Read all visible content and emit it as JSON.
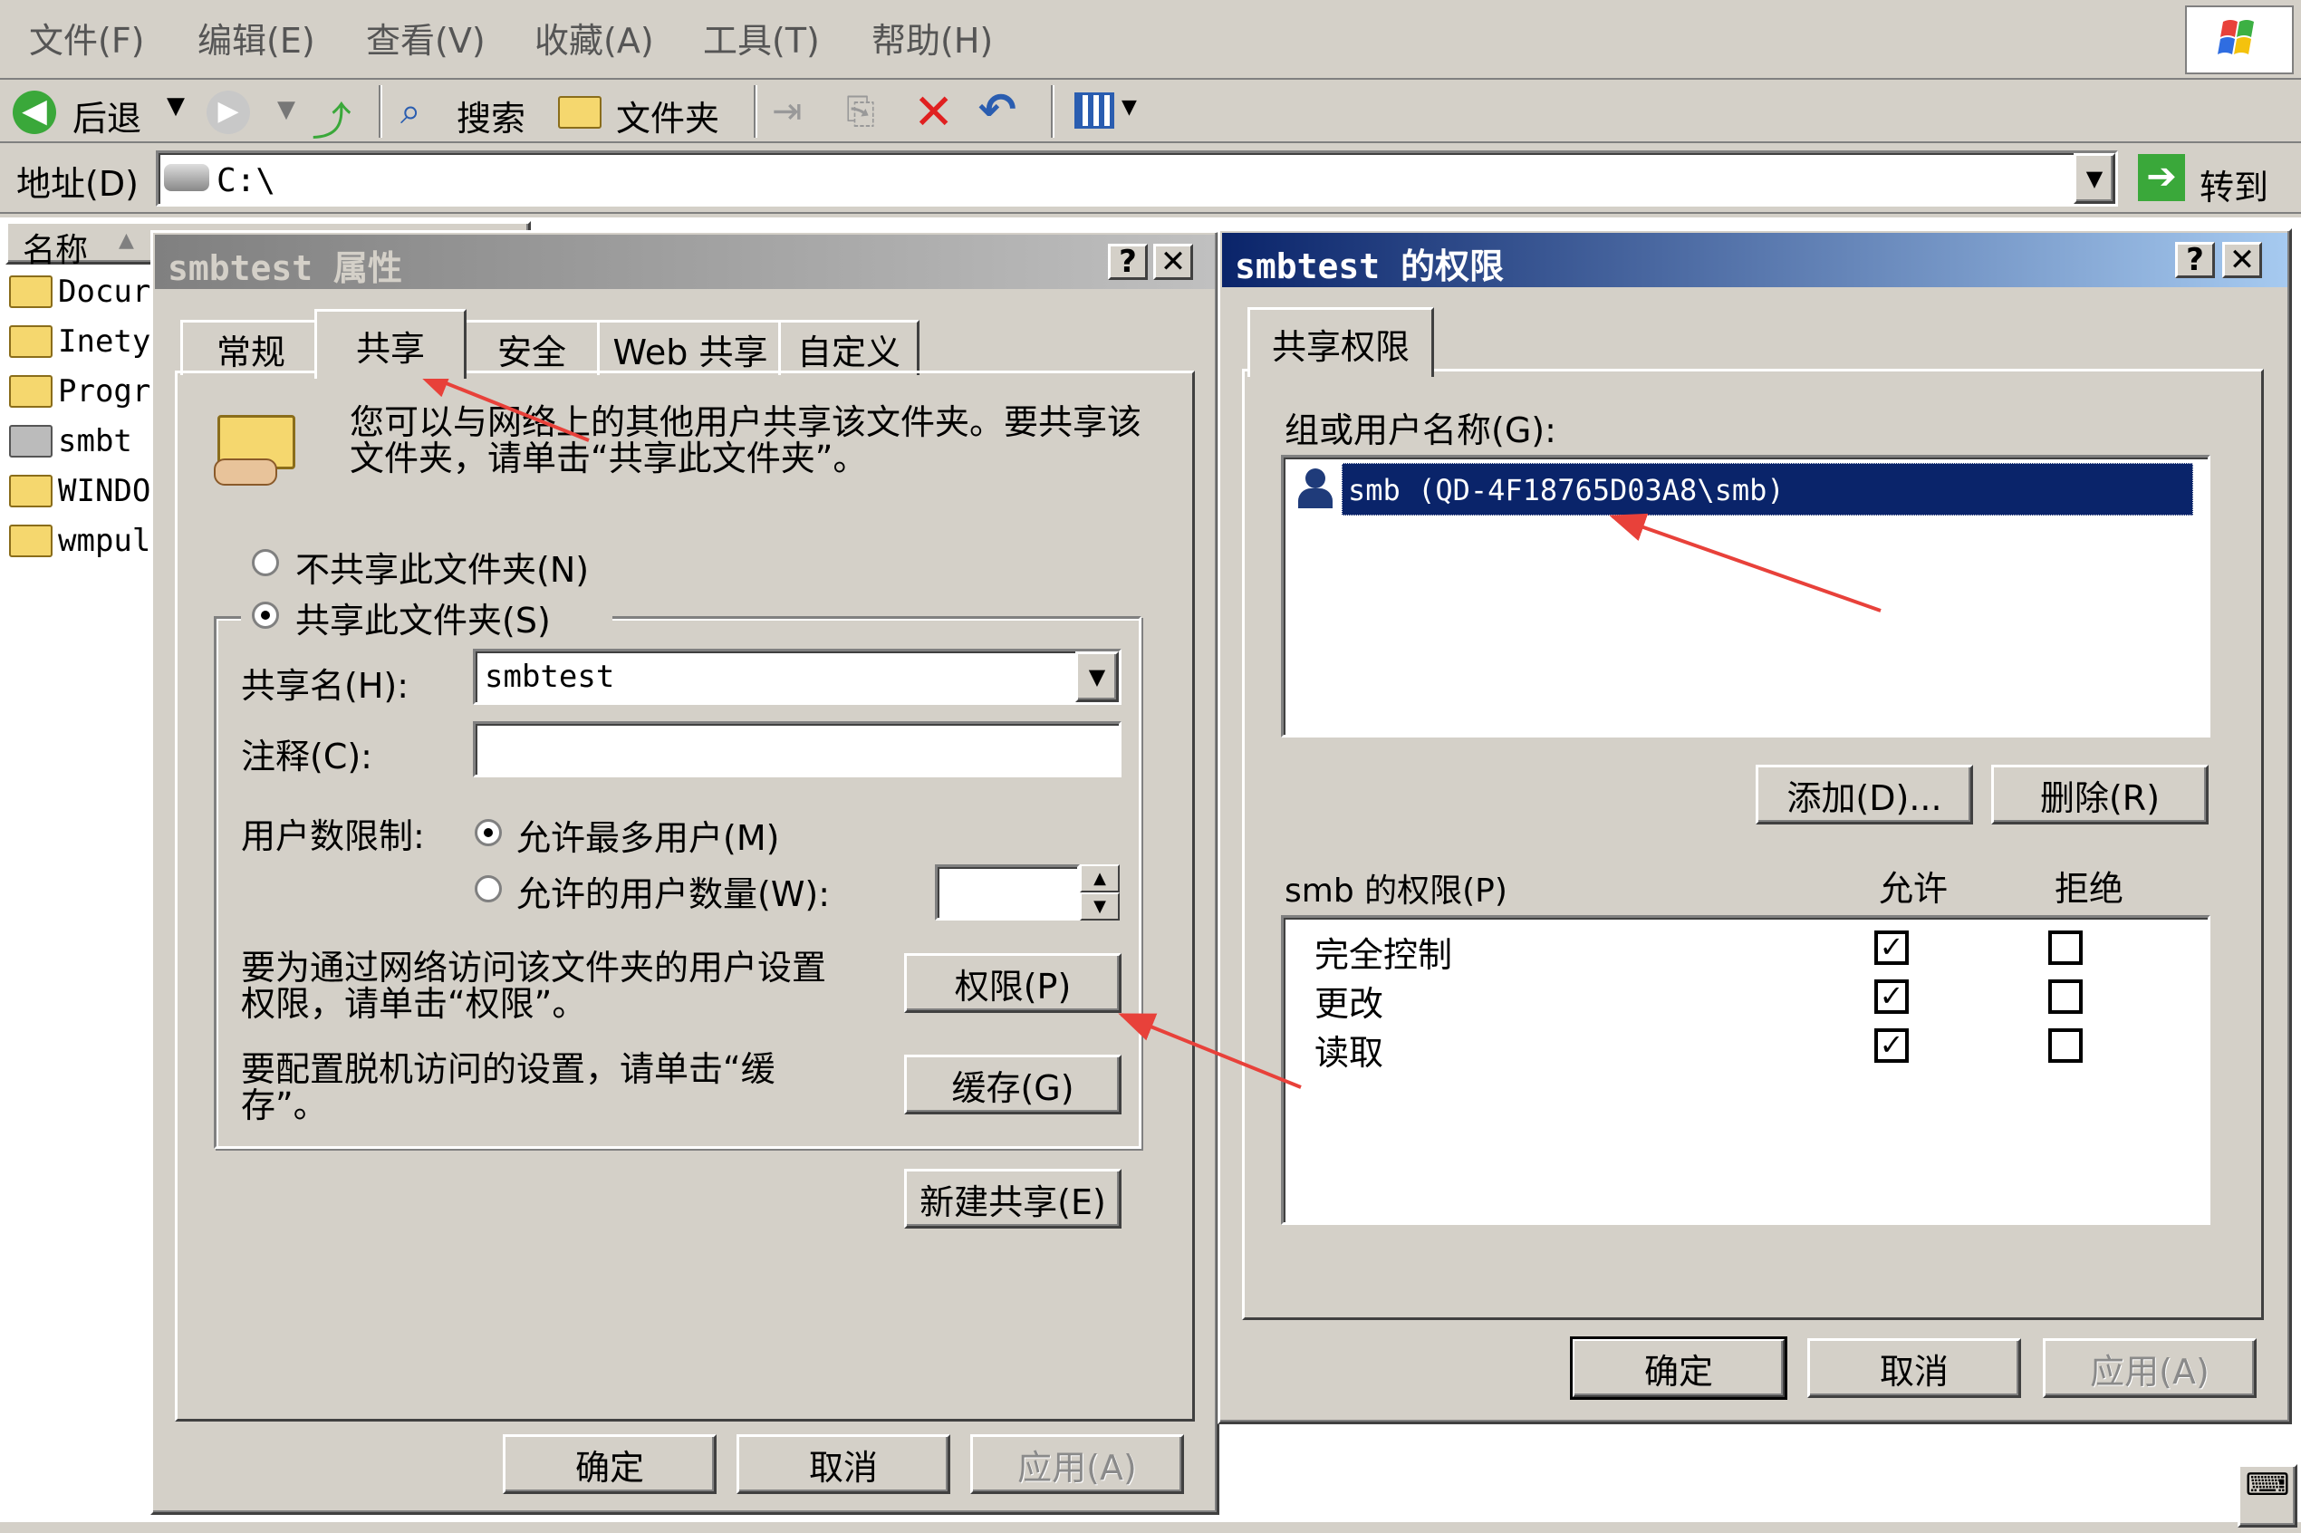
{
  "menu": [
    "文件(F)",
    "编辑(E)",
    "查看(V)",
    "收藏(A)",
    "工具(T)",
    "帮助(H)"
  ],
  "toolbar": {
    "back": "后退",
    "search": "搜索",
    "folders": "文件夹"
  },
  "address": {
    "label": "地址(D)",
    "value": "C:\\",
    "go": "转到"
  },
  "explorer": {
    "column_name": "名称",
    "items": [
      "Docur",
      "Inety",
      "Progr",
      "smbt",
      "WINDO",
      "wmpul"
    ]
  },
  "properties_dialog": {
    "title": "smbtest 属性",
    "tabs": [
      "常规",
      "共享",
      "安全",
      "Web 共享",
      "自定义"
    ],
    "info": "您可以与网络上的其他用户共享该文件夹。要共享该文件夹，请单击“共享此文件夹”。",
    "no_share": "不共享此文件夹(N)",
    "share": "共享此文件夹(S)",
    "share_name_label": "共享名(H):",
    "share_name_value": "smbtest",
    "comment_label": "注释(C):",
    "user_limit_label": "用户数限制:",
    "max_users": "允许最多用户(M)",
    "allowed_users": "允许的用户数量(W):",
    "permissions_text": "要为通过网络访问该文件夹的用户设置权限，请单击“权限”。",
    "permissions_button": "权限(P)",
    "cache_text": "要配置脱机访问的设置，请单击“缓存”。",
    "cache_button": "缓存(G)",
    "new_share_button": "新建共享(E)",
    "ok": "确定",
    "cancel": "取消",
    "apply": "应用(A)"
  },
  "permissions_dialog": {
    "title": "smbtest 的权限",
    "tab": "共享权限",
    "group_label": "组或用户名称(G):",
    "selected_user": "smb (QD-4F18765D03A8\\smb)",
    "add_button": "添加(D)...",
    "remove_button": "删除(R)",
    "perm_label": "smb 的权限(P)",
    "allow_header": "允许",
    "deny_header": "拒绝",
    "permissions": [
      {
        "name": "完全控制",
        "allow": "✓",
        "deny": ""
      },
      {
        "name": "更改",
        "allow": "✓",
        "deny": ""
      },
      {
        "name": "读取",
        "allow": "✓",
        "deny": ""
      }
    ],
    "ok": "确定",
    "cancel": "取消",
    "apply": "应用(A)"
  },
  "colors": {
    "selection": "#0a246a",
    "annotation_arrow": "#e8413a"
  }
}
